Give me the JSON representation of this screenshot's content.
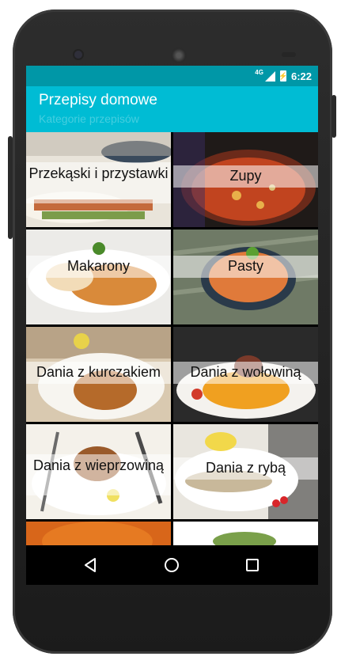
{
  "status": {
    "network": "4G",
    "battery_icon": "battery-charging-icon",
    "time": "6:22"
  },
  "app": {
    "title": "Przepisy domowe",
    "subtitle": "Kategorie przepisów",
    "accent": "#00bcd4",
    "status_color": "#0097a7"
  },
  "categories": [
    {
      "label": "Przekąski i przystawki"
    },
    {
      "label": "Zupy"
    },
    {
      "label": "Makarony"
    },
    {
      "label": "Pasty"
    },
    {
      "label": "Dania z kurczakiem"
    },
    {
      "label": "Dania z wołowiną"
    },
    {
      "label": "Dania z wieprzowiną"
    },
    {
      "label": "Dania z rybą"
    }
  ],
  "navigation": {
    "back": "back-icon",
    "home": "home-icon",
    "recents": "recents-icon"
  }
}
